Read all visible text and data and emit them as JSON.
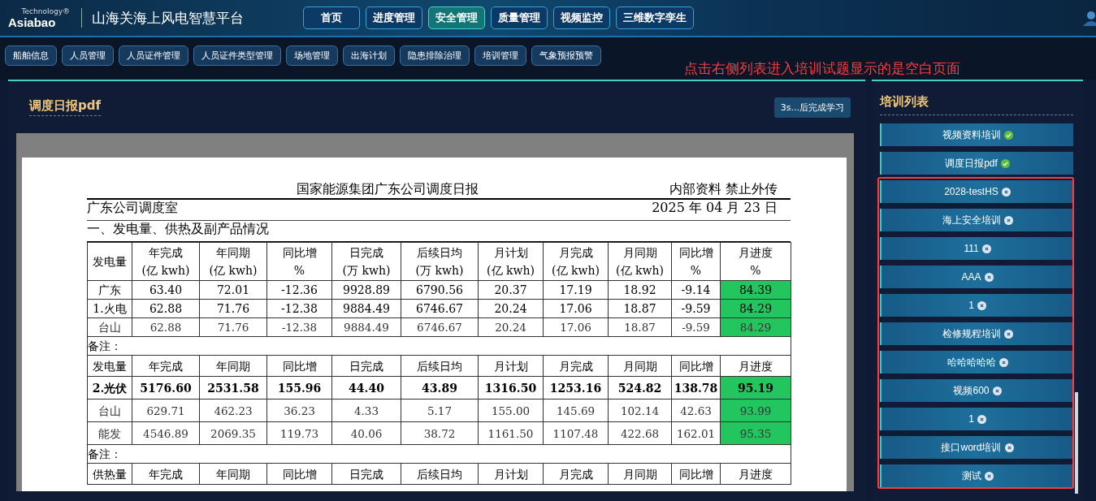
{
  "header": {
    "logo": {
      "brand": "Asiabao",
      "tagline": "Technology®"
    },
    "title": "山海关海上风电智慧平台",
    "nav": [
      {
        "label": "首页",
        "selected": false
      },
      {
        "label": "进度管理",
        "selected": false
      },
      {
        "label": "安全管理",
        "selected": true
      },
      {
        "label": "质量管理",
        "selected": false
      },
      {
        "label": "视频监控",
        "selected": false
      },
      {
        "label": "三维数字孪生",
        "selected": false
      }
    ]
  },
  "subnav": [
    {
      "label": "船舶信息"
    },
    {
      "label": "人员管理"
    },
    {
      "label": "人员证件管理"
    },
    {
      "label": "人员证件类型管理"
    },
    {
      "label": "场地管理"
    },
    {
      "label": "出海计划"
    },
    {
      "label": "隐患排除治理"
    },
    {
      "label": "培训管理"
    },
    {
      "label": "气象预报预警"
    }
  ],
  "annotation": "点击右侧列表进入培训试题显示的是空白页面",
  "viewer": {
    "title": "调度日报pdf",
    "timer_button": "3s...后完成学习",
    "doc": {
      "title": "国家能源集团广东公司调度日报",
      "confidential": "内部资料  禁止外传",
      "dept": "广东公司调度室",
      "date": "2025 年 04 月 23 日",
      "section": "一、发电量、供热及副产品情况",
      "blocks": [
        {
          "header": [
            "发电量",
            "年完成\n(亿 kwh)",
            "年同期\n(亿 kwh)",
            "同比增\n%",
            "日完成\n(万 kwh)",
            "后续日均\n(万 kwh)",
            "月计划\n(亿 kwh)",
            "月完成\n(亿 kwh)",
            "月同期\n(亿  kwh)",
            "同比增\n%",
            "月进度\n%"
          ],
          "rows": [
            {
              "kind": "total",
              "color": "#22c55e",
              "cells": [
                "广东",
                "63.40",
                "72.01",
                "-12.36",
                "9928.89",
                "6790.56",
                "20.37",
                "17.19",
                "18.92",
                "-9.14",
                "84.39"
              ]
            },
            {
              "kind": "total",
              "color": "#22c55e",
              "cells": [
                "1.火电",
                "62.88",
                "71.76",
                "-12.38",
                "9884.49",
                "6746.67",
                "20.24",
                "17.06",
                "18.87",
                "-9.59",
                "84.29"
              ]
            },
            {
              "kind": "detail",
              "color": "#22c55e",
              "cells": [
                "台山",
                "62.88",
                "71.76",
                "-12.38",
                "9884.49",
                "6746.67",
                "20.24",
                "17.06",
                "18.87",
                "-9.59",
                "84.29"
              ]
            }
          ],
          "note": "备注："
        },
        {
          "header": [
            "发电量",
            "年完成",
            "年同期",
            "同比增",
            "日完成",
            "后续日均",
            "月计划",
            "月完成",
            "月同期",
            "同比增",
            "月进度"
          ],
          "rows": [
            {
              "kind": "total",
              "color": "#22c55e",
              "cells": [
                "2.光伏",
                "5176.60",
                "2531.58",
                "155.96",
                "44.40",
                "43.89",
                "1316.50",
                "1253.16",
                "524.82",
                "138.78",
                "95.19"
              ]
            },
            {
              "kind": "detail",
              "color": "#22c55e",
              "cells": [
                "台山",
                "629.71",
                "462.23",
                "36.23",
                "4.33",
                "5.17",
                "155.00",
                "145.69",
                "102.14",
                "42.63",
                "93.99"
              ]
            },
            {
              "kind": "detail",
              "color": "#22c55e",
              "cells": [
                "能发",
                "4546.89",
                "2069.35",
                "119.73",
                "40.06",
                "38.72",
                "1161.50",
                "1107.48",
                "422.68",
                "162.01",
                "95.35"
              ]
            }
          ],
          "note": "备注："
        },
        {
          "header": [
            "供热量",
            "年完成",
            "年同期",
            "同比增",
            "日完成",
            "后续日均",
            "月计划",
            "月完成",
            "月同期",
            "同比增",
            "月进度"
          ]
        }
      ]
    }
  },
  "training": {
    "title": "培训列表",
    "items": [
      {
        "label": "视频资料培训",
        "done": true
      },
      {
        "label": "调度日报pdf",
        "done": true
      },
      {
        "label": "2028-testHS",
        "done": false
      },
      {
        "label": "海上安全培训",
        "done": false
      },
      {
        "label": "111",
        "done": false
      },
      {
        "label": "AAA",
        "done": false
      },
      {
        "label": "1",
        "done": false
      },
      {
        "label": "检修规程培训",
        "done": false
      },
      {
        "label": "哈哈哈哈哈",
        "done": false
      },
      {
        "label": "视频600",
        "done": false
      },
      {
        "label": "1",
        "done": false
      },
      {
        "label": "接口word培训",
        "done": false
      },
      {
        "label": "测试",
        "done": false
      }
    ]
  }
}
